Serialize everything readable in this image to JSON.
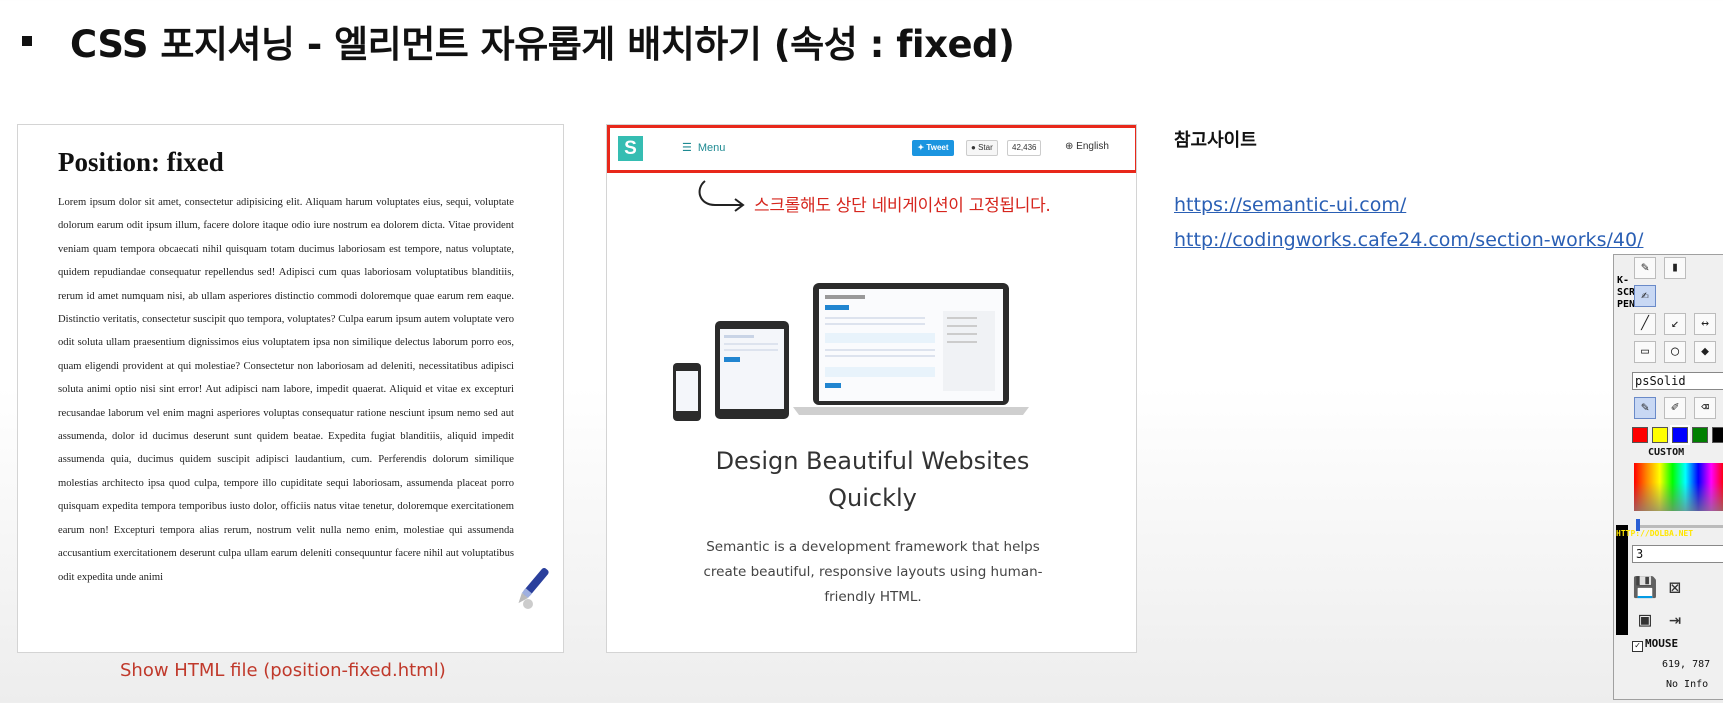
{
  "slide": {
    "title": "CSS 포지셔닝 - 엘리먼트 자유롭게 배치하기 (속성 : fixed)"
  },
  "doc_panel": {
    "heading": "Position: fixed",
    "body": "Lorem ipsum dolor sit amet, consectetur adipisicing elit. Aliquam harum voluptates eius, sequi, voluptate dolorum earum odit ipsum illum, facere dolore itaque odio iure nostrum ea dolorem dicta. Vitae provident veniam quam tempora obcaecati nihil quisquam totam ducimus laboriosam est tempore, natus voluptate, quidem repudiandae consequatur repellendus sed! Adipisci cum quas laboriosam voluptatibus blanditiis, rerum id amet numquam nisi, ab ullam asperiores distinctio commodi doloremque quae earum rem eaque. Distinctio veritatis, consectetur suscipit quo tempora, voluptates? Culpa earum ipsum autem voluptate vero odit soluta ullam praesentium dignissimos eius voluptatem ipsa non similique delectus laborum porro eos, quam eligendi provident at qui molestiae? Consectetur non laboriosam ad deleniti, necessitatibus adipisci soluta animi optio nisi sint error! Aut adipisci nam labore, impedit quaerat. Aliquid et vitae ex excepturi recusandae laborum vel enim magni asperiores voluptas consequatur ratione nesciunt ipsum nemo sed aut assumenda, dolor id ducimus deserunt sunt quidem beatae. Expedita fugiat blanditiis, aliquid impedit assumenda quia, ducimus quidem suscipit adipisci laudantium, cum. Perferendis dolorum similique molestias architecto ipsa quod culpa, tempore illo cupiditate sequi laboriosam, assumenda placeat porro quisquam expedita tempora temporibus iusto dolor, officiis natus vitae tenetur, doloremque exercitationem earum non! Excepturi tempora alias rerum, nostrum velit nulla nemo enim, molestiae qui assumenda accusantium exercitationem deserunt culpa ullam earum deleniti consequuntur facere nihil aut voluptatibus odit expedita unde animi",
    "caption": "Show HTML file (position-fixed.html)"
  },
  "site_panel": {
    "logo_letter": "S",
    "menu_label": "Menu",
    "tweet_label": "Tweet",
    "star_label": "Star",
    "star_count": "42,436",
    "lang_label": "English",
    "annotation": "스크롤해도 상단 네비게이션이 고정됩니다.",
    "hero_title_line1": "Design Beautiful Websites",
    "hero_title_line2": "Quickly",
    "hero_sub": "Semantic is a development framework that helps create beautiful, responsive layouts using human-friendly HTML.",
    "nav_highlight_color": "#e8281a",
    "brand_color": "#35bdb2"
  },
  "reference": {
    "label": "참고사이트",
    "link1": "https://semantic-ui.com/",
    "link2": "http://codingworks.cafe24.com/section-works/40/"
  },
  "pen_toolbar": {
    "vertical_title": "K-SCREEN PEN",
    "vertical_url": "HTTP://DOLBA.NET",
    "pen_style": "psSolid",
    "custom_label": "CUSTOM",
    "swatches": [
      "#ff0000",
      "#ffff00",
      "#0000ff",
      "#008000",
      "#000000"
    ],
    "width_value": "3",
    "mouse_label": "MOUSE",
    "mouse_checked": true,
    "coords": "619, 787",
    "info": "No Info"
  }
}
